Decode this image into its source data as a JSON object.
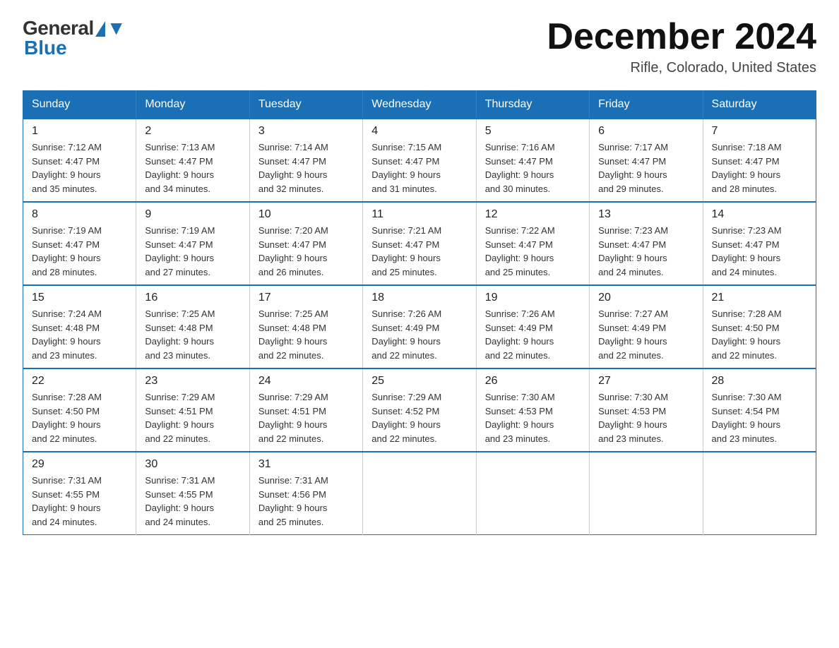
{
  "logo": {
    "general": "General",
    "blue": "Blue"
  },
  "title": "December 2024",
  "location": "Rifle, Colorado, United States",
  "days_of_week": [
    "Sunday",
    "Monday",
    "Tuesday",
    "Wednesday",
    "Thursday",
    "Friday",
    "Saturday"
  ],
  "weeks": [
    [
      {
        "day": "1",
        "sunrise": "7:12 AM",
        "sunset": "4:47 PM",
        "daylight": "9 hours and 35 minutes."
      },
      {
        "day": "2",
        "sunrise": "7:13 AM",
        "sunset": "4:47 PM",
        "daylight": "9 hours and 34 minutes."
      },
      {
        "day": "3",
        "sunrise": "7:14 AM",
        "sunset": "4:47 PM",
        "daylight": "9 hours and 32 minutes."
      },
      {
        "day": "4",
        "sunrise": "7:15 AM",
        "sunset": "4:47 PM",
        "daylight": "9 hours and 31 minutes."
      },
      {
        "day": "5",
        "sunrise": "7:16 AM",
        "sunset": "4:47 PM",
        "daylight": "9 hours and 30 minutes."
      },
      {
        "day": "6",
        "sunrise": "7:17 AM",
        "sunset": "4:47 PM",
        "daylight": "9 hours and 29 minutes."
      },
      {
        "day": "7",
        "sunrise": "7:18 AM",
        "sunset": "4:47 PM",
        "daylight": "9 hours and 28 minutes."
      }
    ],
    [
      {
        "day": "8",
        "sunrise": "7:19 AM",
        "sunset": "4:47 PM",
        "daylight": "9 hours and 28 minutes."
      },
      {
        "day": "9",
        "sunrise": "7:19 AM",
        "sunset": "4:47 PM",
        "daylight": "9 hours and 27 minutes."
      },
      {
        "day": "10",
        "sunrise": "7:20 AM",
        "sunset": "4:47 PM",
        "daylight": "9 hours and 26 minutes."
      },
      {
        "day": "11",
        "sunrise": "7:21 AM",
        "sunset": "4:47 PM",
        "daylight": "9 hours and 25 minutes."
      },
      {
        "day": "12",
        "sunrise": "7:22 AM",
        "sunset": "4:47 PM",
        "daylight": "9 hours and 25 minutes."
      },
      {
        "day": "13",
        "sunrise": "7:23 AM",
        "sunset": "4:47 PM",
        "daylight": "9 hours and 24 minutes."
      },
      {
        "day": "14",
        "sunrise": "7:23 AM",
        "sunset": "4:47 PM",
        "daylight": "9 hours and 24 minutes."
      }
    ],
    [
      {
        "day": "15",
        "sunrise": "7:24 AM",
        "sunset": "4:48 PM",
        "daylight": "9 hours and 23 minutes."
      },
      {
        "day": "16",
        "sunrise": "7:25 AM",
        "sunset": "4:48 PM",
        "daylight": "9 hours and 23 minutes."
      },
      {
        "day": "17",
        "sunrise": "7:25 AM",
        "sunset": "4:48 PM",
        "daylight": "9 hours and 22 minutes."
      },
      {
        "day": "18",
        "sunrise": "7:26 AM",
        "sunset": "4:49 PM",
        "daylight": "9 hours and 22 minutes."
      },
      {
        "day": "19",
        "sunrise": "7:26 AM",
        "sunset": "4:49 PM",
        "daylight": "9 hours and 22 minutes."
      },
      {
        "day": "20",
        "sunrise": "7:27 AM",
        "sunset": "4:49 PM",
        "daylight": "9 hours and 22 minutes."
      },
      {
        "day": "21",
        "sunrise": "7:28 AM",
        "sunset": "4:50 PM",
        "daylight": "9 hours and 22 minutes."
      }
    ],
    [
      {
        "day": "22",
        "sunrise": "7:28 AM",
        "sunset": "4:50 PM",
        "daylight": "9 hours and 22 minutes."
      },
      {
        "day": "23",
        "sunrise": "7:29 AM",
        "sunset": "4:51 PM",
        "daylight": "9 hours and 22 minutes."
      },
      {
        "day": "24",
        "sunrise": "7:29 AM",
        "sunset": "4:51 PM",
        "daylight": "9 hours and 22 minutes."
      },
      {
        "day": "25",
        "sunrise": "7:29 AM",
        "sunset": "4:52 PM",
        "daylight": "9 hours and 22 minutes."
      },
      {
        "day": "26",
        "sunrise": "7:30 AM",
        "sunset": "4:53 PM",
        "daylight": "9 hours and 23 minutes."
      },
      {
        "day": "27",
        "sunrise": "7:30 AM",
        "sunset": "4:53 PM",
        "daylight": "9 hours and 23 minutes."
      },
      {
        "day": "28",
        "sunrise": "7:30 AM",
        "sunset": "4:54 PM",
        "daylight": "9 hours and 23 minutes."
      }
    ],
    [
      {
        "day": "29",
        "sunrise": "7:31 AM",
        "sunset": "4:55 PM",
        "daylight": "9 hours and 24 minutes."
      },
      {
        "day": "30",
        "sunrise": "7:31 AM",
        "sunset": "4:55 PM",
        "daylight": "9 hours and 24 minutes."
      },
      {
        "day": "31",
        "sunrise": "7:31 AM",
        "sunset": "4:56 PM",
        "daylight": "9 hours and 25 minutes."
      },
      {
        "day": "",
        "sunrise": "",
        "sunset": "",
        "daylight": ""
      },
      {
        "day": "",
        "sunrise": "",
        "sunset": "",
        "daylight": ""
      },
      {
        "day": "",
        "sunrise": "",
        "sunset": "",
        "daylight": ""
      },
      {
        "day": "",
        "sunrise": "",
        "sunset": "",
        "daylight": ""
      }
    ]
  ],
  "labels": {
    "sunrise": "Sunrise: ",
    "sunset": "Sunset: ",
    "daylight": "Daylight: "
  }
}
